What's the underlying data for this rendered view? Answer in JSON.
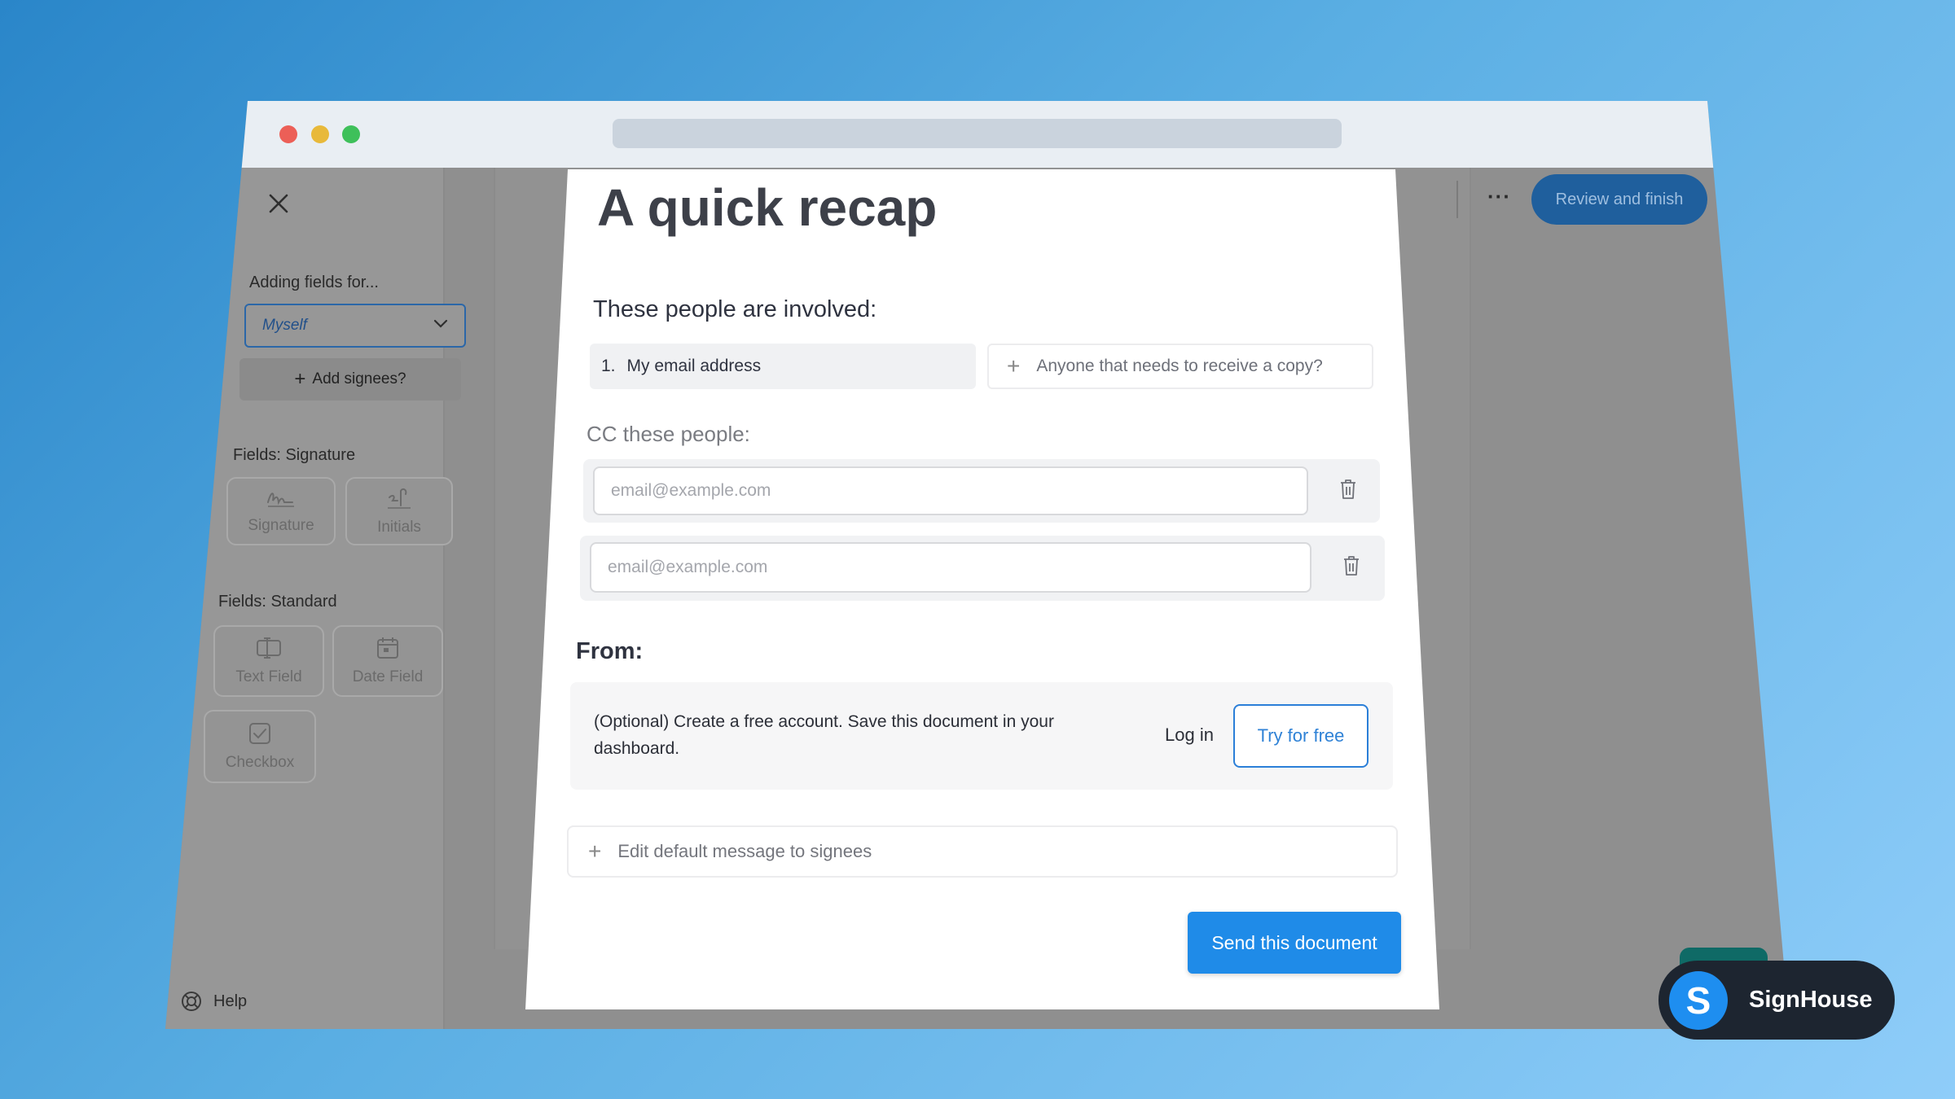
{
  "sidebar": {
    "adding_fields_label": "Adding fields for...",
    "signer_select_value": "Myself",
    "add_signees_label": "Add signees?",
    "signature_section_title": "Fields: Signature",
    "signature_fields": [
      {
        "label": "Signature",
        "icon": "signature-icon"
      },
      {
        "label": "Initials",
        "icon": "initials-icon"
      }
    ],
    "standard_section_title": "Fields: Standard",
    "standard_fields": [
      {
        "label": "Text Field",
        "icon": "text-field-icon"
      },
      {
        "label": "Date Field",
        "icon": "calendar-icon"
      },
      {
        "label": "Checkbox",
        "icon": "checkbox-icon"
      }
    ],
    "help_label": "Help"
  },
  "toolbar": {
    "more_label": "···",
    "review_button": "Review and finish"
  },
  "modal": {
    "title": "A quick recap",
    "people_heading": "These people are involved:",
    "signees": [
      {
        "number": "1.",
        "label": "My email address"
      }
    ],
    "add_copy_placeholder": "Anyone that needs to receive a copy?",
    "cc_heading": "CC these people:",
    "cc_fields": [
      {
        "placeholder": "email@example.com",
        "value": ""
      },
      {
        "placeholder": "email@example.com",
        "value": ""
      }
    ],
    "from_heading": "From:",
    "from_text": "(Optional) Create a free account. Save this document in your dashboard.",
    "login_label": "Log in",
    "try_free_label": "Try for free",
    "edit_message_label": "Edit default message to signees",
    "send_button": "Send this document"
  },
  "brand": {
    "logo_letter": "S",
    "name": "SignHouse"
  },
  "colors": {
    "accent": "#1f8be8",
    "brand_dark": "#1d2530",
    "title_text": "#3d4049"
  }
}
